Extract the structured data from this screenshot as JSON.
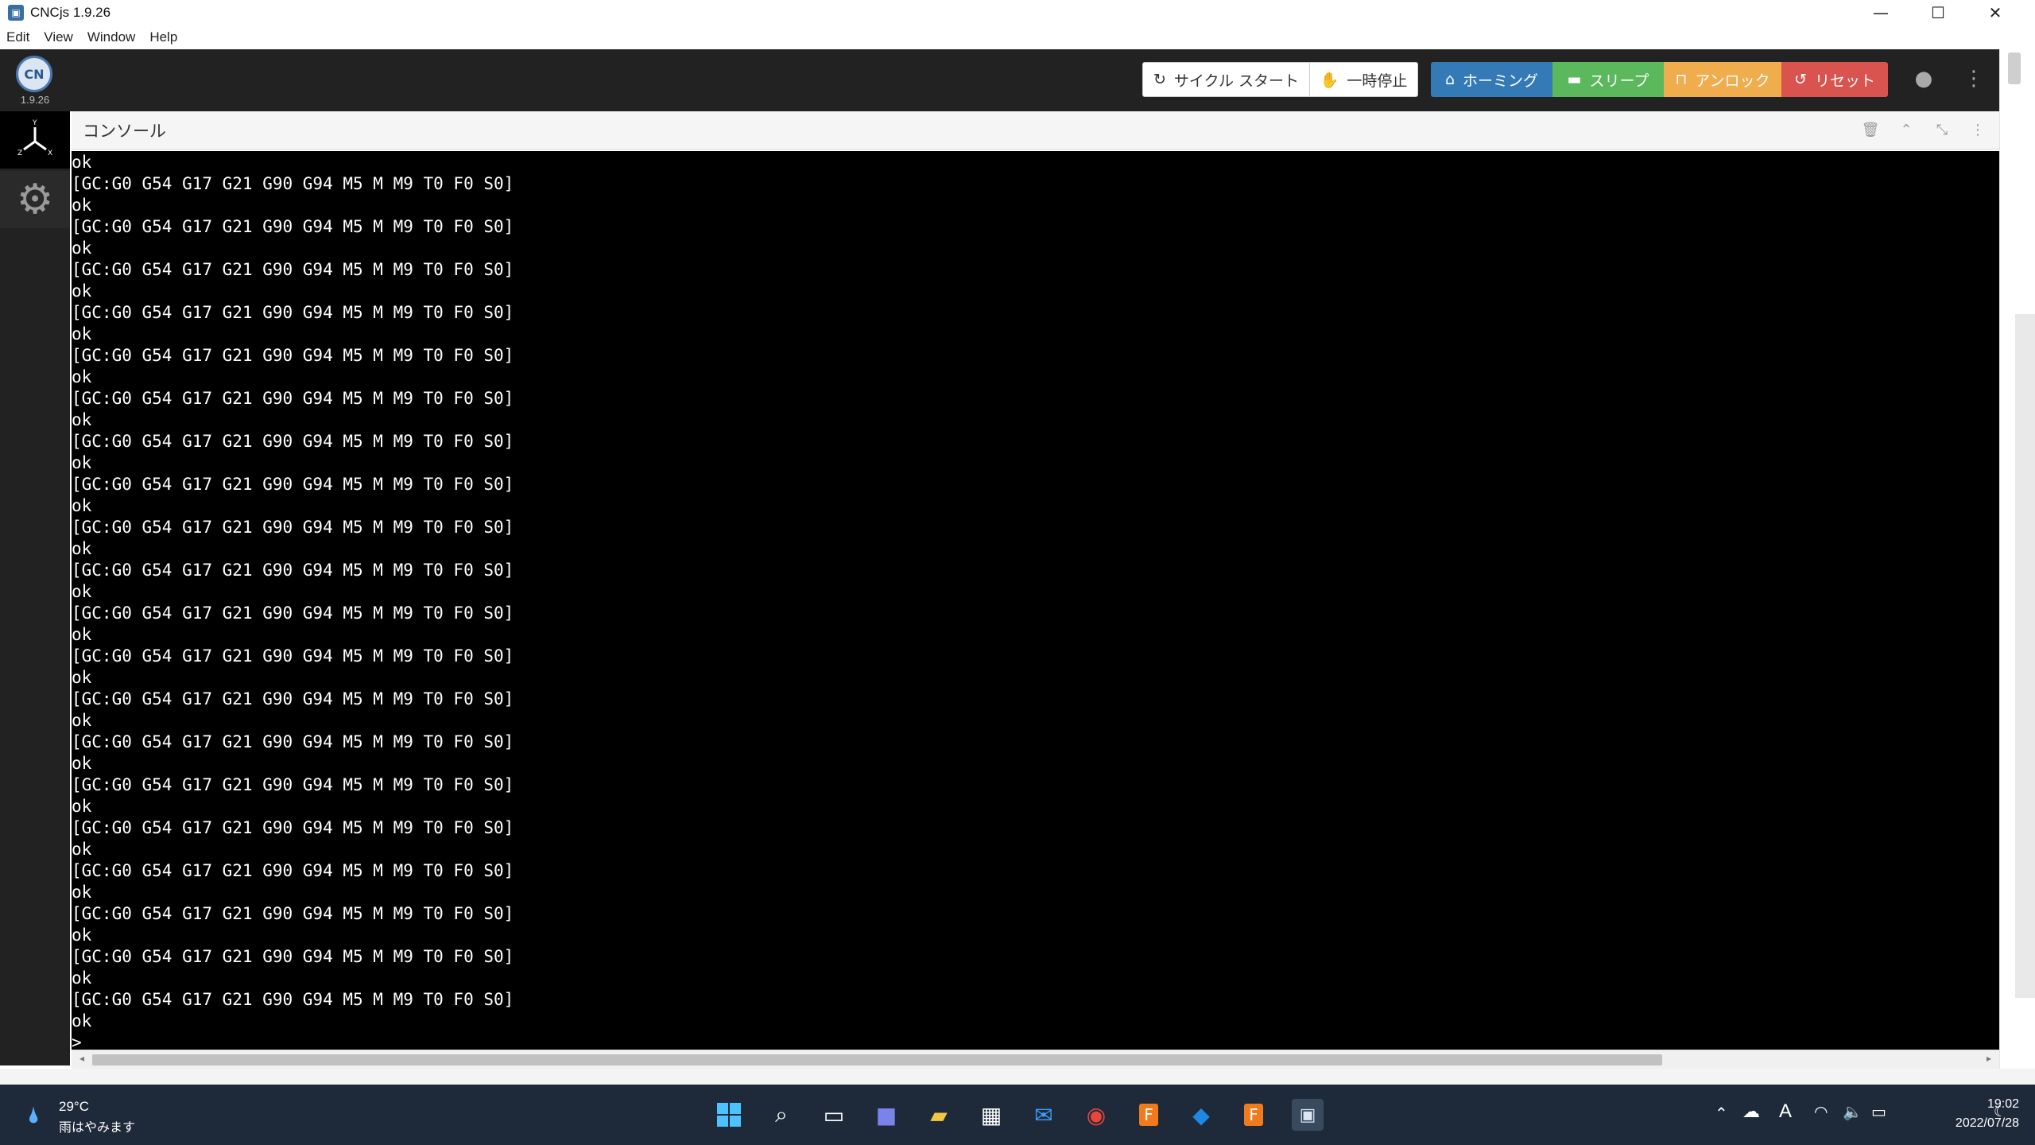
{
  "window": {
    "title": "CNCjs 1.9.26",
    "minimize": "—",
    "maximize": "☐",
    "close": "✕"
  },
  "menu": [
    "Edit",
    "View",
    "Window",
    "Help"
  ],
  "header": {
    "version": "1.9.26",
    "cycle_start": "サイクル スタート",
    "feed_hold": "一時停止",
    "homing": "ホーミング",
    "sleep": "スリープ",
    "unlock": "アンロック",
    "reset": "リセット",
    "colors": {
      "homing": "#337ab7",
      "sleep": "#5cb85c",
      "unlock": "#f0ad4e",
      "reset": "#d9534f"
    }
  },
  "sidebar": {
    "items": [
      {
        "icon": "axes-icon"
      },
      {
        "icon": "gear-icon"
      }
    ]
  },
  "console": {
    "title": "コンソール",
    "lines": [
      "ok",
      "[GC:G0 G54 G17 G21 G90 G94 M5 M M9 T0 F0 S0]",
      "ok",
      "[GC:G0 G54 G17 G21 G90 G94 M5 M M9 T0 F0 S0]",
      "ok",
      "[GC:G0 G54 G17 G21 G90 G94 M5 M M9 T0 F0 S0]",
      "ok",
      "[GC:G0 G54 G17 G21 G90 G94 M5 M M9 T0 F0 S0]",
      "ok",
      "[GC:G0 G54 G17 G21 G90 G94 M5 M M9 T0 F0 S0]",
      "ok",
      "[GC:G0 G54 G17 G21 G90 G94 M5 M M9 T0 F0 S0]",
      "ok",
      "[GC:G0 G54 G17 G21 G90 G94 M5 M M9 T0 F0 S0]",
      "ok",
      "[GC:G0 G54 G17 G21 G90 G94 M5 M M9 T0 F0 S0]",
      "ok",
      "[GC:G0 G54 G17 G21 G90 G94 M5 M M9 T0 F0 S0]",
      "ok",
      "[GC:G0 G54 G17 G21 G90 G94 M5 M M9 T0 F0 S0]",
      "ok",
      "[GC:G0 G54 G17 G21 G90 G94 M5 M M9 T0 F0 S0]",
      "ok",
      "[GC:G0 G54 G17 G21 G90 G94 M5 M M9 T0 F0 S0]",
      "ok",
      "[GC:G0 G54 G17 G21 G90 G94 M5 M M9 T0 F0 S0]",
      "ok",
      "[GC:G0 G54 G17 G21 G90 G94 M5 M M9 T0 F0 S0]",
      "ok",
      "[GC:G0 G54 G17 G21 G90 G94 M5 M M9 T0 F0 S0]",
      "ok",
      "[GC:G0 G54 G17 G21 G90 G94 M5 M M9 T0 F0 S0]",
      "ok",
      "[GC:G0 G54 G17 G21 G90 G94 M5 M M9 T0 F0 S0]",
      "ok",
      "[GC:G0 G54 G17 G21 G90 G94 M5 M M9 T0 F0 S0]",
      "ok",
      "[GC:G0 G54 G17 G21 G90 G94 M5 M M9 T0 F0 S0]",
      "ok",
      "[GC:G0 G54 G17 G21 G90 G94 M5 M M9 T0 F0 S0]",
      "ok"
    ],
    "prompt": ">"
  },
  "taskbar": {
    "weather_temp": "29°C",
    "weather_desc": "雨はやみます",
    "apps": [
      "start-icon",
      "search-icon",
      "task-view-icon",
      "teams-icon",
      "file-explorer-icon",
      "store-icon",
      "mail-icon",
      "chrome-icon",
      "fusion360-icon",
      "app-icon",
      "fusion360-icon",
      "cncjs-icon"
    ],
    "ime": "A",
    "time": "19:02",
    "date": "2022/07/28"
  }
}
